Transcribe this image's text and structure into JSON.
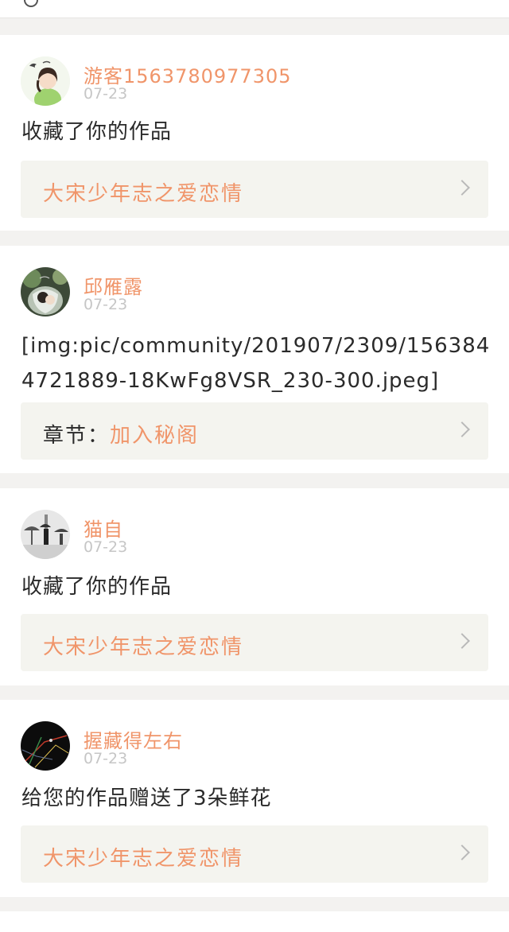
{
  "colors": {
    "accent": "#f0956a",
    "page_bg": "#f3f2f0",
    "card_bg": "#ffffff",
    "link_box_bg": "#f4f4ef",
    "date": "#c6c6c6",
    "body_text": "#2a2a2a"
  },
  "notifications": [
    {
      "user": "游客1563780977305",
      "date": "07-23",
      "message": "收藏了你的作品",
      "link_prefix": "",
      "link_text": "大宋少年志之爱恋情",
      "avatar_icon": "girl-with-bird-avatar"
    },
    {
      "user": "邱雁露",
      "date": "07-23",
      "message": "[img:pic/community/201907/2309/1563844721889-18KwFg8VSR_230-300.jpeg]",
      "link_prefix": "章节：",
      "link_text": "加入秘阁",
      "avatar_icon": "couple-photo-avatar"
    },
    {
      "user": "猫自",
      "date": "07-23",
      "message": "收藏了你的作品",
      "link_prefix": "",
      "link_text": "大宋少年志之爱恋情",
      "avatar_icon": "street-umbrella-avatar"
    },
    {
      "user": "握藏得左右",
      "date": "07-23",
      "message": "给您的作品赠送了3朵鲜花",
      "link_prefix": "",
      "link_text": "大宋少年志之爱恋情",
      "avatar_icon": "dark-abstract-avatar"
    }
  ],
  "icons": {
    "back": "back-arrow-icon",
    "chevron": "chevron-right-icon"
  }
}
